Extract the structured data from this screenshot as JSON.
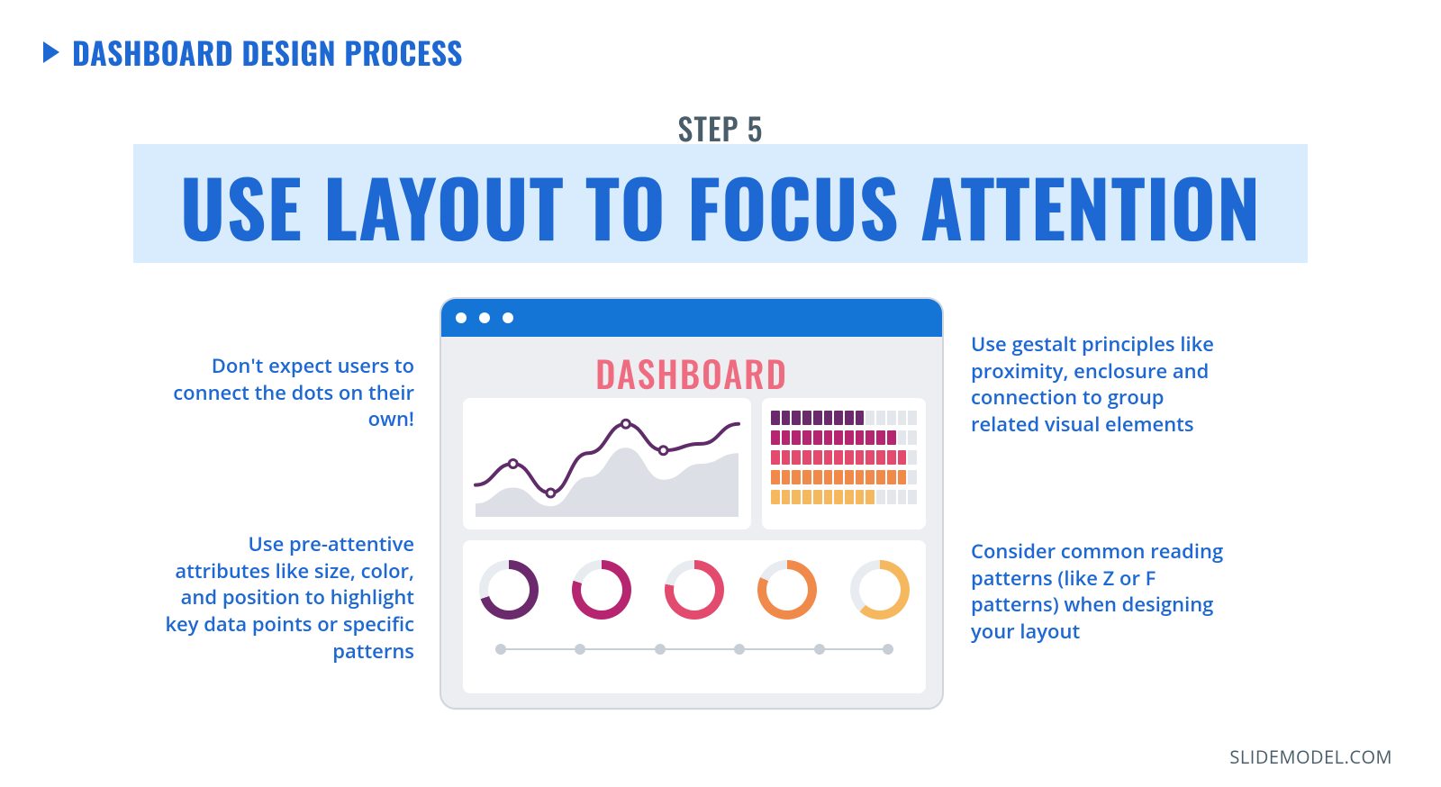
{
  "header": {
    "label": "DASHBOARD DESIGN PROCESS"
  },
  "step": "STEP 5",
  "title": "USE LAYOUT TO FOCUS ATTENTION",
  "tips": {
    "top_left": "Don't expect users to connect the dots on their own!",
    "bottom_left": "Use pre-attentive attributes like size, color, and position to highlight key data points or specific patterns",
    "top_right": "Use gestalt principles like proximity, enclosure and connection to group related visual elements",
    "bottom_right": "Consider common reading patterns (like Z or F patterns) when designing your layout"
  },
  "mock": {
    "title": "DASHBOARD",
    "donut_colors": [
      "#6b2a6b",
      "#b6256f",
      "#e24a6e",
      "#f08a4a",
      "#f6b85e"
    ],
    "donut_fractions": [
      0.7,
      0.8,
      0.78,
      0.82,
      0.62
    ],
    "bar_row_colors": [
      "#6b2a6b",
      "#b6256f",
      "#e24a6e",
      "#f08a4a",
      "#f6b85e"
    ],
    "bar_row_fills": [
      9,
      12,
      13,
      13,
      10
    ],
    "bar_segments": 14
  },
  "chart_data": {
    "type": "line",
    "title": "",
    "xlabel": "",
    "ylabel": "",
    "x": [
      0,
      1,
      2,
      3,
      4,
      5,
      6,
      7
    ],
    "series": [
      {
        "name": "dark-line",
        "values": [
          24,
          40,
          18,
          48,
          70,
          50,
          55,
          70
        ]
      },
      {
        "name": "light-area",
        "values": [
          10,
          22,
          8,
          30,
          52,
          28,
          40,
          48
        ]
      }
    ],
    "ylim": [
      0,
      80
    ],
    "xlim": [
      0,
      7
    ]
  },
  "footer": "SLIDEMODEL.COM"
}
